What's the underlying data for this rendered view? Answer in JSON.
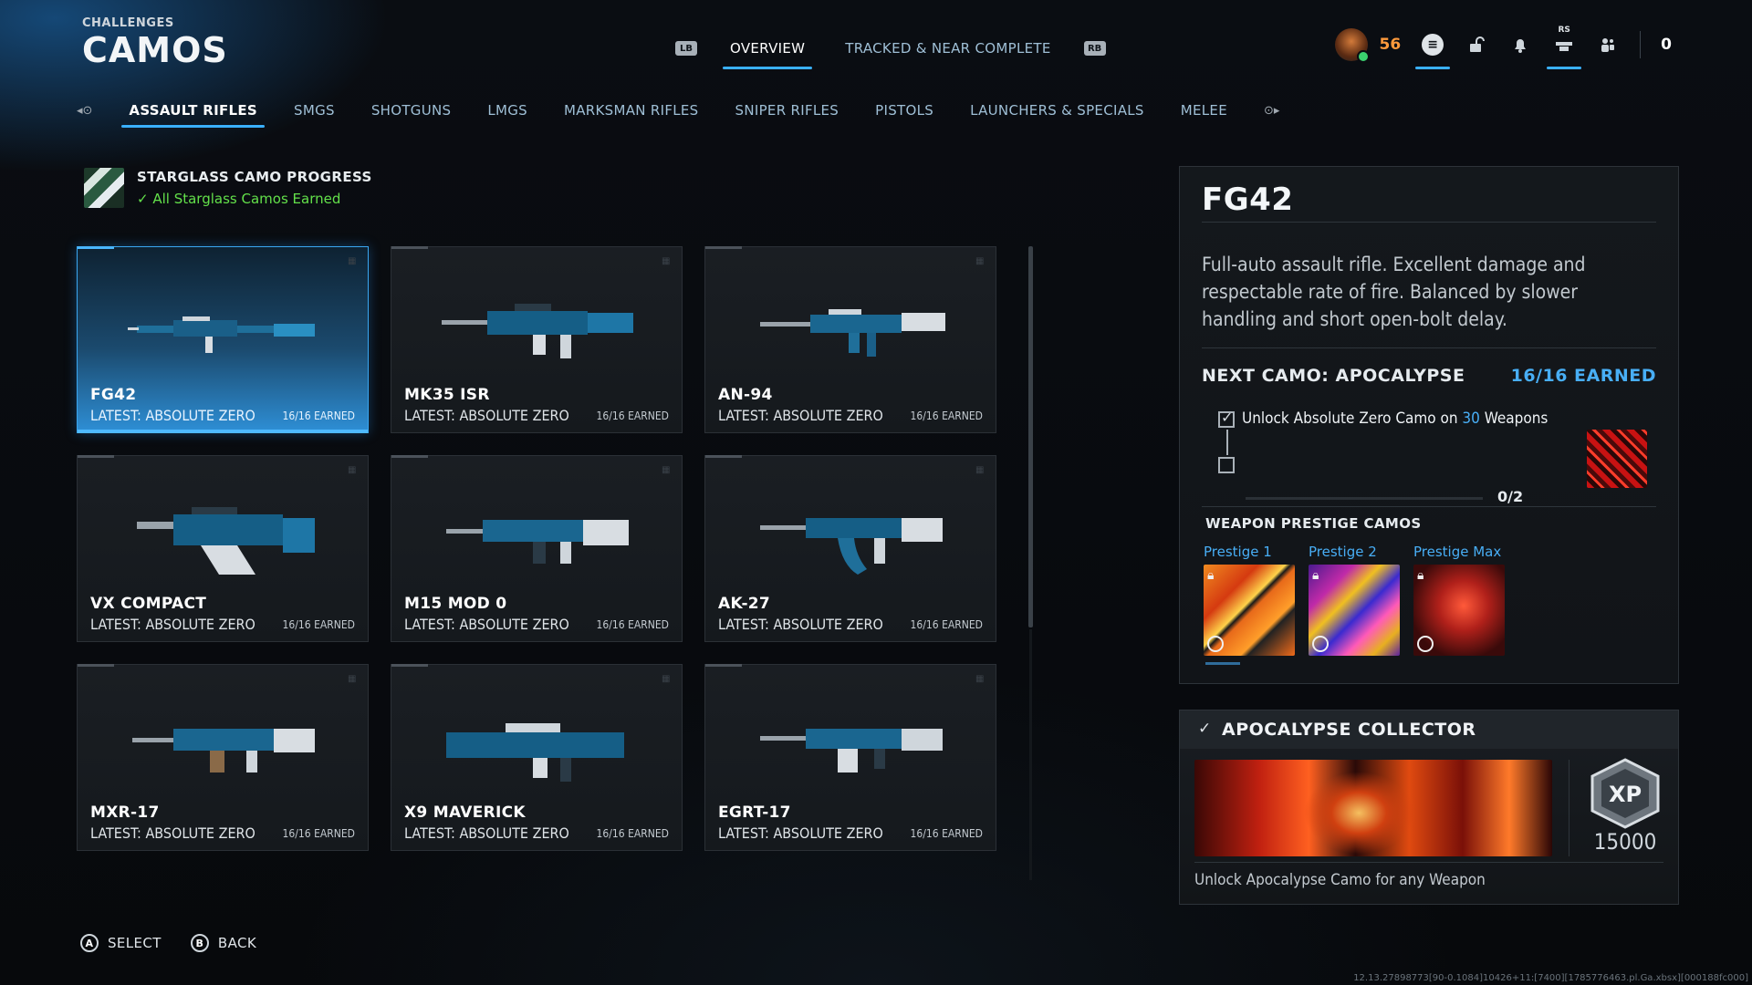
{
  "header": {
    "section": "CHALLENGES",
    "title": "CAMOS"
  },
  "top_tabs": {
    "left_bumper": "LB",
    "right_bumper": "RB",
    "items": [
      {
        "label": "OVERVIEW",
        "active": true
      },
      {
        "label": "TRACKED & NEAR COMPLETE",
        "active": false
      }
    ]
  },
  "hud": {
    "level": "56",
    "rs_tag": "RS",
    "count": "0"
  },
  "categories": {
    "left_key": "LB",
    "right_key": "RB",
    "items": [
      {
        "label": "ASSAULT RIFLES",
        "active": true
      },
      {
        "label": "SMGS"
      },
      {
        "label": "SHOTGUNS"
      },
      {
        "label": "LMGS"
      },
      {
        "label": "MARKSMAN RIFLES"
      },
      {
        "label": "SNIPER RIFLES"
      },
      {
        "label": "PISTOLS"
      },
      {
        "label": "LAUNCHERS & SPECIALS"
      },
      {
        "label": "MELEE"
      }
    ]
  },
  "progress": {
    "title": "STARGLASS CAMO PROGRESS",
    "status": "All Starglass Camos Earned"
  },
  "weapons": [
    {
      "name": "FG42",
      "latest": "LATEST: ABSOLUTE ZERO",
      "earned": "16/16 EARNED",
      "selected": true
    },
    {
      "name": "MK35 ISR",
      "latest": "LATEST: ABSOLUTE ZERO",
      "earned": "16/16 EARNED"
    },
    {
      "name": "AN-94",
      "latest": "LATEST: ABSOLUTE ZERO",
      "earned": "16/16 EARNED"
    },
    {
      "name": "VX COMPACT",
      "latest": "LATEST: ABSOLUTE ZERO",
      "earned": "16/16 EARNED"
    },
    {
      "name": "M15 MOD 0",
      "latest": "LATEST: ABSOLUTE ZERO",
      "earned": "16/16 EARNED"
    },
    {
      "name": "AK-27",
      "latest": "LATEST: ABSOLUTE ZERO",
      "earned": "16/16 EARNED"
    },
    {
      "name": "MXR-17",
      "latest": "LATEST: ABSOLUTE ZERO",
      "earned": "16/16 EARNED"
    },
    {
      "name": "X9 MAVERICK",
      "latest": "LATEST: ABSOLUTE ZERO",
      "earned": "16/16 EARNED"
    },
    {
      "name": "EGRT-17",
      "latest": "LATEST: ABSOLUTE ZERO",
      "earned": "16/16 EARNED"
    }
  ],
  "detail": {
    "title": "FG42",
    "description": "Full-auto assault rifle. Excellent damage and respectable rate of fire. Balanced by slower handling and short open-bolt delay.",
    "next_camo": "NEXT CAMO: APOCALYPSE",
    "next_earned": "16/16 EARNED",
    "task_prefix": "Unlock Absolute Zero Camo on",
    "task_number": "30",
    "task_suffix": "Weapons",
    "task_count": "0/2",
    "prestige_title": "WEAPON PRESTIGE CAMOS",
    "prestige": [
      {
        "label": "Prestige 1"
      },
      {
        "label": "Prestige 2"
      },
      {
        "label": "Prestige Max"
      }
    ]
  },
  "collector": {
    "title": "APOCALYPSE COLLECTOR",
    "xp_badge": "XP",
    "xp_amount": "15000",
    "description": "Unlock Apocalypse Camo for any Weapon"
  },
  "footer": {
    "select_key": "A",
    "select_label": "SELECT",
    "back_key": "B",
    "back_label": "BACK"
  },
  "build_info": "12.13.27898773[90-0.1084]10426+11:[7400][1785776463.pl.Ga.xbsx][000188fc000]",
  "colors": {
    "accent": "#3ab0ff",
    "earned_green": "#63e04a",
    "level_orange": "#ff9a3c"
  }
}
